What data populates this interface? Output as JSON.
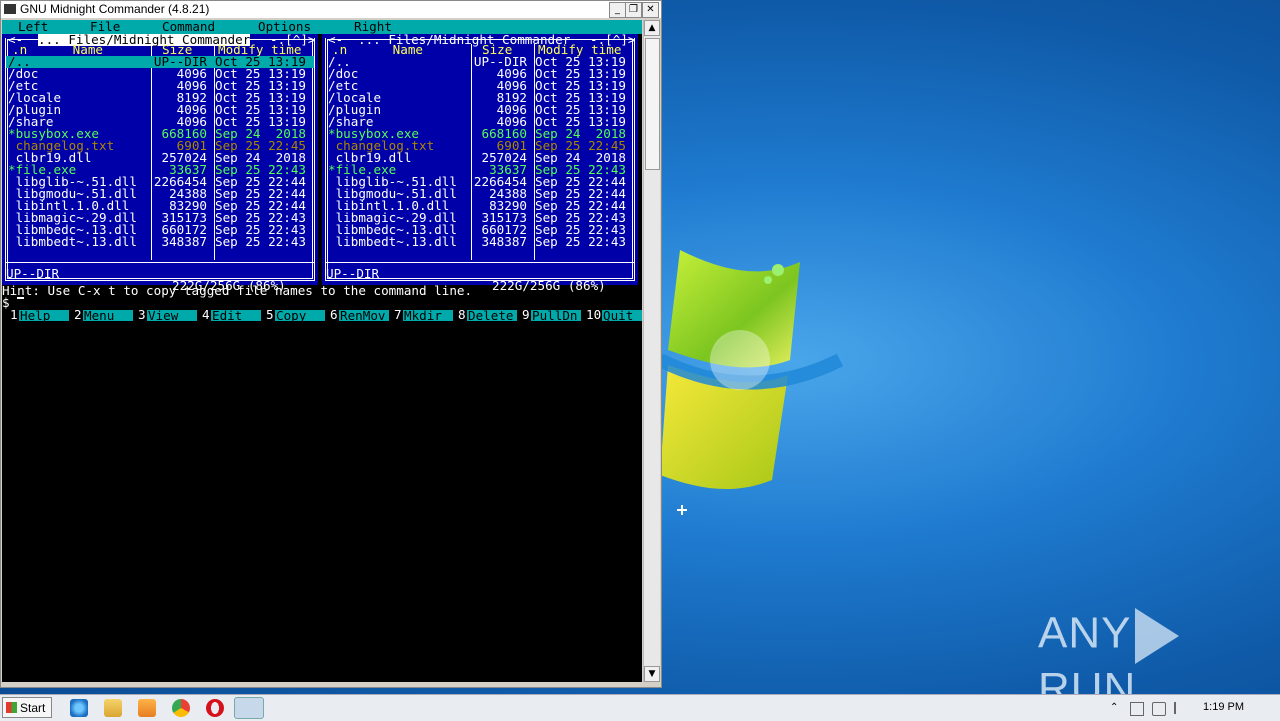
{
  "window": {
    "title": "GNU Midnight Commander (4.8.21)",
    "min_label": "_",
    "max_label": "❐",
    "close_label": "✕"
  },
  "menu": {
    "items": [
      "Left",
      "File",
      "Command",
      "Options",
      "Right"
    ]
  },
  "left_panel": {
    "header": " ... Files/Midnight Commander ",
    "corner_left": "<-",
    "corner_right": "-.[^]>",
    "col_name": ".n      Name",
    "col_size": "Size",
    "col_modify": "Modify time",
    "files": [
      {
        "name": "/..",
        "size": "UP--DIR",
        "modified": "Oct 25 13:19",
        "type": "dir",
        "selected": true
      },
      {
        "name": "/doc",
        "size": "4096",
        "modified": "Oct 25 13:19",
        "type": "dir"
      },
      {
        "name": "/etc",
        "size": "4096",
        "modified": "Oct 25 13:19",
        "type": "dir"
      },
      {
        "name": "/locale",
        "size": "8192",
        "modified": "Oct 25 13:19",
        "type": "dir"
      },
      {
        "name": "/plugin",
        "size": "4096",
        "modified": "Oct 25 13:19",
        "type": "dir"
      },
      {
        "name": "/share",
        "size": "4096",
        "modified": "Oct 25 13:19",
        "type": "dir"
      },
      {
        "name": "*busybox.exe",
        "size": "668160",
        "modified": "Sep 24  2018",
        "type": "exe"
      },
      {
        "name": " changelog.txt",
        "size": "6901",
        "modified": "Sep 25 22:45",
        "type": "txt"
      },
      {
        "name": " clbr19.dll",
        "size": "257024",
        "modified": "Sep 24  2018",
        "type": "dll"
      },
      {
        "name": "*file.exe",
        "size": "33637",
        "modified": "Sep 25 22:43",
        "type": "exe"
      },
      {
        "name": " libglib-~.51.dll",
        "size": "2266454",
        "modified": "Sep 25 22:44",
        "type": "dll"
      },
      {
        "name": " libgmodu~.51.dll",
        "size": "24388",
        "modified": "Sep 25 22:44",
        "type": "dll"
      },
      {
        "name": " libintl.1.0.dll",
        "size": "83290",
        "modified": "Sep 25 22:44",
        "type": "dll"
      },
      {
        "name": " libmagic~.29.dll",
        "size": "315173",
        "modified": "Sep 25 22:43",
        "type": "dll"
      },
      {
        "name": " libmbedc~.13.dll",
        "size": "660172",
        "modified": "Sep 25 22:43",
        "type": "dll"
      },
      {
        "name": " libmbedt~.13.dll",
        "size": "348387",
        "modified": "Sep 25 22:43",
        "type": "dll"
      }
    ],
    "mini_status": "UP--DIR",
    "disk_space": "222G/256G (86%)"
  },
  "right_panel": {
    "header": " ... Files/Midnight Commander ",
    "corner_left": "<-",
    "corner_right": "-.[^]>",
    "col_name": ".n      Name",
    "col_size": "Size",
    "col_modify": "Modify time",
    "files": [
      {
        "name": "/..",
        "size": "UP--DIR",
        "modified": "Oct 25 13:19",
        "type": "dir"
      },
      {
        "name": "/doc",
        "size": "4096",
        "modified": "Oct 25 13:19",
        "type": "dir"
      },
      {
        "name": "/etc",
        "size": "4096",
        "modified": "Oct 25 13:19",
        "type": "dir"
      },
      {
        "name": "/locale",
        "size": "8192",
        "modified": "Oct 25 13:19",
        "type": "dir"
      },
      {
        "name": "/plugin",
        "size": "4096",
        "modified": "Oct 25 13:19",
        "type": "dir"
      },
      {
        "name": "/share",
        "size": "4096",
        "modified": "Oct 25 13:19",
        "type": "dir"
      },
      {
        "name": "*busybox.exe",
        "size": "668160",
        "modified": "Sep 24  2018",
        "type": "exe"
      },
      {
        "name": " changelog.txt",
        "size": "6901",
        "modified": "Sep 25 22:45",
        "type": "txt"
      },
      {
        "name": " clbr19.dll",
        "size": "257024",
        "modified": "Sep 24  2018",
        "type": "dll"
      },
      {
        "name": "*file.exe",
        "size": "33637",
        "modified": "Sep 25 22:43",
        "type": "exe"
      },
      {
        "name": " libglib-~.51.dll",
        "size": "2266454",
        "modified": "Sep 25 22:44",
        "type": "dll"
      },
      {
        "name": " libgmodu~.51.dll",
        "size": "24388",
        "modified": "Sep 25 22:44",
        "type": "dll"
      },
      {
        "name": " libintl.1.0.dll",
        "size": "83290",
        "modified": "Sep 25 22:44",
        "type": "dll"
      },
      {
        "name": " libmagic~.29.dll",
        "size": "315173",
        "modified": "Sep 25 22:43",
        "type": "dll"
      },
      {
        "name": " libmbedc~.13.dll",
        "size": "660172",
        "modified": "Sep 25 22:43",
        "type": "dll"
      },
      {
        "name": " libmbedt~.13.dll",
        "size": "348387",
        "modified": "Sep 25 22:43",
        "type": "dll"
      }
    ],
    "mini_status": "UP--DIR",
    "disk_space": "222G/256G (86%)"
  },
  "hint": "Hint: Use C-x t to copy tagged file names to the command line.",
  "prompt": "$ ",
  "function_keys": [
    {
      "num": "1",
      "label": "Help"
    },
    {
      "num": "2",
      "label": "Menu"
    },
    {
      "num": "3",
      "label": "View"
    },
    {
      "num": "4",
      "label": "Edit"
    },
    {
      "num": "5",
      "label": "Copy"
    },
    {
      "num": "6",
      "label": "RenMov"
    },
    {
      "num": "7",
      "label": "Mkdir"
    },
    {
      "num": "8",
      "label": "Delete"
    },
    {
      "num": "9",
      "label": "PullDn"
    },
    {
      "num": "10",
      "label": "Quit"
    }
  ],
  "colors": {
    "panel_bg": "#0000a8",
    "cyan": "#00aaaa",
    "exe": "#55ff55",
    "txt": "#aa8800",
    "header_yellow": "#ffff55"
  },
  "taskbar": {
    "start_label": "Start",
    "clock": "1:19 PM",
    "icons": [
      "ie-icon",
      "explorer-icon",
      "media-player-icon",
      "chrome-icon",
      "opera-icon",
      "mc-task-icon"
    ]
  },
  "watermark": {
    "left": "ANY",
    "right": "RUN"
  }
}
